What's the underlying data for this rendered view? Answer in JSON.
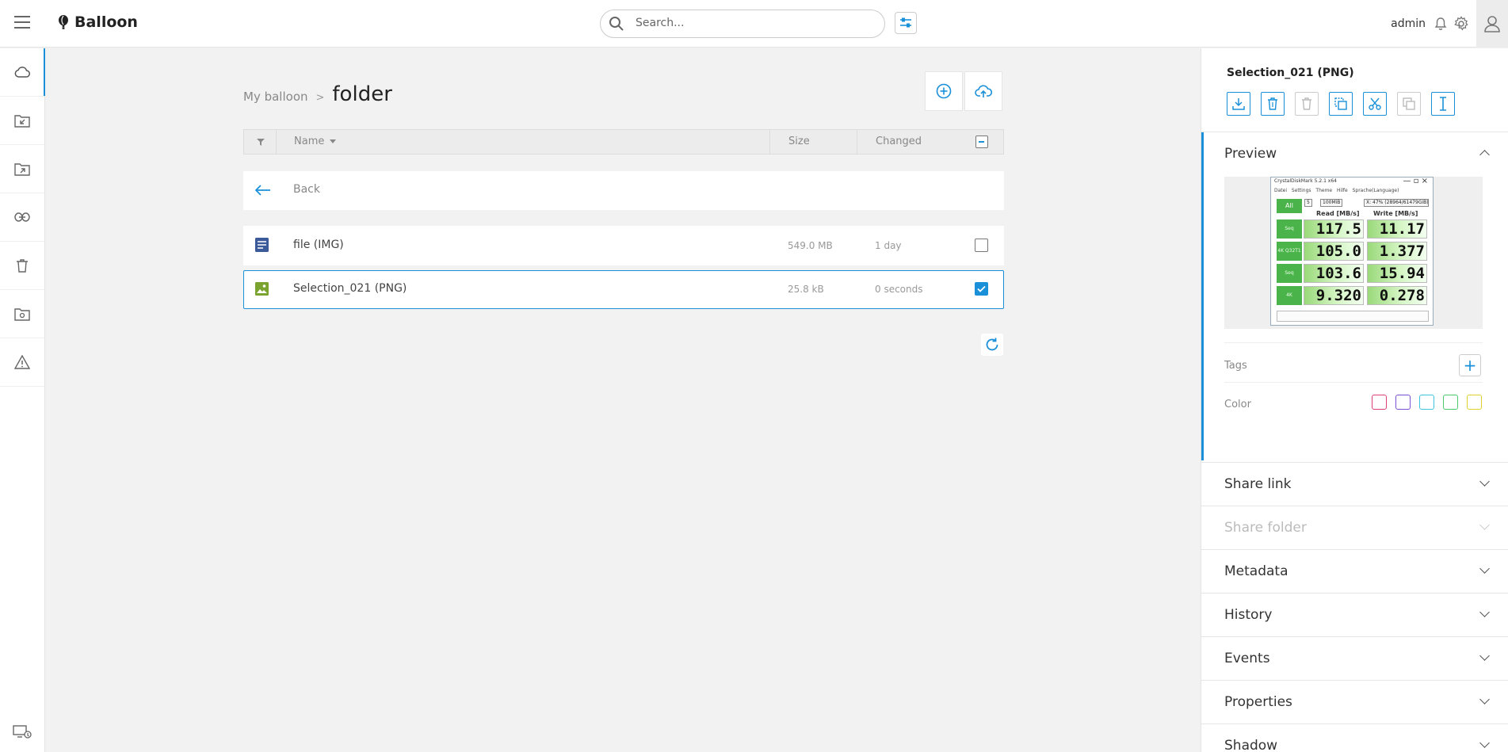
{
  "app": {
    "name": "Balloon"
  },
  "header": {
    "search_placeholder": "Search...",
    "username": "admin"
  },
  "nav": {
    "items": [
      "cloud-icon",
      "inbox-share-icon",
      "outbox-share-icon",
      "link-icon",
      "trash-icon",
      "shared-folder-icon",
      "warning-icon"
    ],
    "bottom": "sync-device-icon"
  },
  "breadcrumb": {
    "root": "My balloon",
    "separator": ">",
    "current": "folder"
  },
  "list": {
    "headers": {
      "name": "Name",
      "size": "Size",
      "changed": "Changed"
    },
    "back_label": "Back",
    "rows": [
      {
        "name": "file (IMG)",
        "size": "549.0 MB",
        "changed": "1 day",
        "selected": false,
        "icon": "document-icon"
      },
      {
        "name": "Selection_021 (PNG)",
        "size": "25.8 kB",
        "changed": "0 seconds",
        "selected": true,
        "icon": "image-icon"
      }
    ]
  },
  "panel": {
    "title": "Selection_021 (PNG)",
    "preview_title": "Preview",
    "tags_label": "Tags",
    "color_label": "Color",
    "swatches": [
      "#e0407a",
      "#7b50d6",
      "#3ec4dd",
      "#4cc96a",
      "#e0d030"
    ],
    "sections": [
      {
        "title": "Share link",
        "disabled": false
      },
      {
        "title": "Share folder",
        "disabled": true
      },
      {
        "title": "Metadata",
        "disabled": false
      },
      {
        "title": "History",
        "disabled": false
      },
      {
        "title": "Events",
        "disabled": false
      },
      {
        "title": "Properties",
        "disabled": false
      },
      {
        "title": "Shadow",
        "disabled": false
      }
    ],
    "thumbnail": {
      "window_title": "CrystalDiskMark 5.2.1 x64",
      "menu": "Datei Settings Theme Hilfe Sprache(Language)",
      "all_label": "All",
      "runs": "5",
      "size": "100MiB",
      "drive": "X: 47% (28964/61479GiB)",
      "read_header": "Read [MB/s]",
      "write_header": "Write [MB/s]",
      "rows": [
        {
          "label": "Seq Q32T1",
          "read": "117.5",
          "write": "11.17"
        },
        {
          "label": "4K Q32T1",
          "read": "105.0",
          "write": "1.377"
        },
        {
          "label": "Seq",
          "read": "103.6",
          "write": "15.94"
        },
        {
          "label": "4K",
          "read": "9.320",
          "write": "0.278"
        }
      ]
    }
  },
  "colors": {
    "accent": "#1a90d9"
  }
}
